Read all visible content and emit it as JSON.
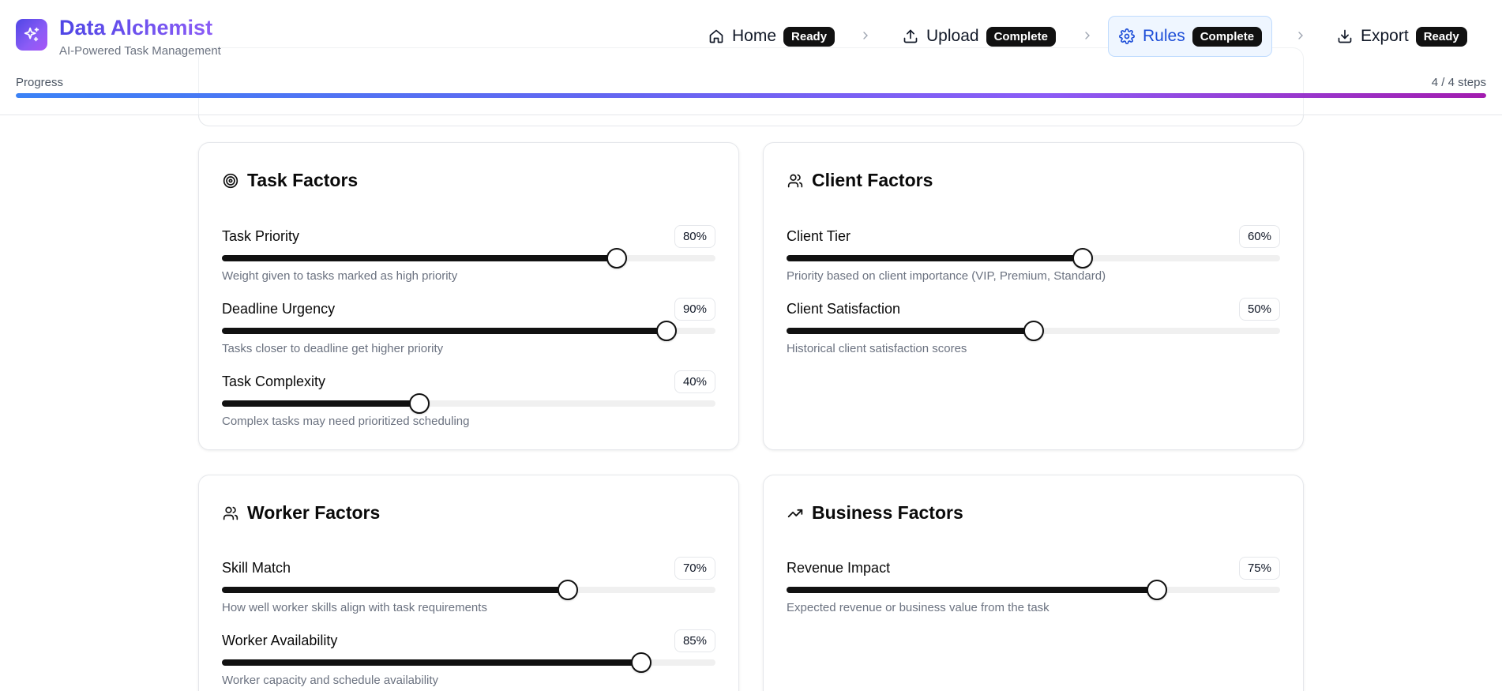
{
  "app": {
    "title": "Data Alchemist",
    "subtitle": "AI-Powered Task Management"
  },
  "steps": [
    {
      "label": "Home",
      "badge": "Ready",
      "icon": "home-icon",
      "active": false
    },
    {
      "label": "Upload",
      "badge": "Complete",
      "icon": "upload-icon",
      "active": false
    },
    {
      "label": "Rules",
      "badge": "Complete",
      "icon": "gear-icon",
      "active": true
    },
    {
      "label": "Export",
      "badge": "Ready",
      "icon": "download-icon",
      "active": false
    }
  ],
  "progress": {
    "label": "Progress",
    "count_text": "4 / 4 steps",
    "value": 1.0
  },
  "colors": {
    "accent": "#4f46e5",
    "active_step_bg": "#eff6ff",
    "badge_bg": "#111111",
    "slider_fill": "#111111"
  },
  "cards": [
    {
      "title": "Task Factors",
      "icon": "target-icon",
      "factors": [
        {
          "name": "Task Priority",
          "value_label": "80%",
          "value": 80,
          "description": "Weight given to tasks marked as high priority"
        },
        {
          "name": "Deadline Urgency",
          "value_label": "90%",
          "value": 90,
          "description": "Tasks closer to deadline get higher priority"
        },
        {
          "name": "Task Complexity",
          "value_label": "40%",
          "value": 40,
          "description": "Complex tasks may need prioritized scheduling"
        }
      ]
    },
    {
      "title": "Client Factors",
      "icon": "users-icon",
      "factors": [
        {
          "name": "Client Tier",
          "value_label": "60%",
          "value": 60,
          "description": "Priority based on client importance (VIP, Premium, Standard)"
        },
        {
          "name": "Client Satisfaction",
          "value_label": "50%",
          "value": 50,
          "description": "Historical client satisfaction scores"
        }
      ]
    },
    {
      "title": "Worker Factors",
      "icon": "users-icon",
      "factors": [
        {
          "name": "Skill Match",
          "value_label": "70%",
          "value": 70,
          "description": "How well worker skills align with task requirements"
        },
        {
          "name": "Worker Availability",
          "value_label": "85%",
          "value": 85,
          "description": "Worker capacity and schedule availability"
        }
      ]
    },
    {
      "title": "Business Factors",
      "icon": "trending-up-icon",
      "factors": [
        {
          "name": "Revenue Impact",
          "value_label": "75%",
          "value": 75,
          "description": "Expected revenue or business value from the task"
        }
      ]
    }
  ]
}
